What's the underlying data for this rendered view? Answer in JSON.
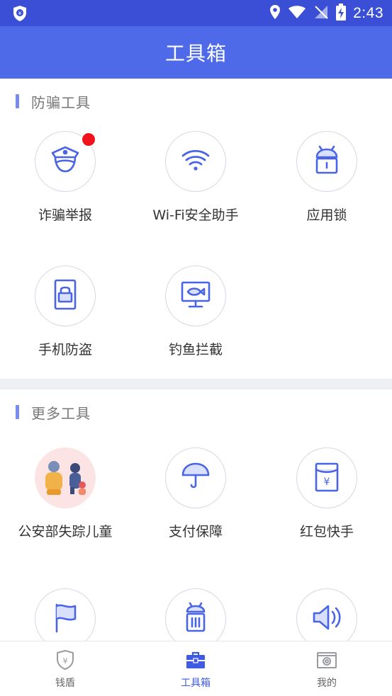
{
  "status_bar": {
    "time": "2:43"
  },
  "app_bar": {
    "title": "工具箱"
  },
  "sections": [
    {
      "title": "防骗工具",
      "tools": [
        {
          "label": "诈骗举报",
          "icon": "police-officer-icon",
          "badge": true
        },
        {
          "label": "Wi-Fi安全助手",
          "icon": "wifi-icon"
        },
        {
          "label": "应用锁",
          "icon": "android-lock-icon"
        },
        {
          "label": "手机防盗",
          "icon": "phone-lock-icon"
        },
        {
          "label": "钓鱼拦截",
          "icon": "fish-monitor-icon"
        }
      ]
    },
    {
      "title": "更多工具",
      "tools": [
        {
          "label": "公安部失踪儿童",
          "icon": "missing-children-illustration"
        },
        {
          "label": "支付保障",
          "icon": "umbrella-icon"
        },
        {
          "label": "红包快手",
          "icon": "red-envelope-yuan-icon"
        },
        {
          "label": "",
          "icon": "flag-icon"
        },
        {
          "label": "",
          "icon": "android-trash-icon"
        },
        {
          "label": "",
          "icon": "speaker-icon"
        }
      ]
    }
  ],
  "bottom_nav": [
    {
      "label": "钱盾",
      "icon": "shield-yuan-icon",
      "active": false
    },
    {
      "label": "工具箱",
      "icon": "toolbox-icon",
      "active": true
    },
    {
      "label": "我的",
      "icon": "profile-card-icon",
      "active": false
    }
  ],
  "colors": {
    "status_bar": "#3a4fd6",
    "app_bar": "#4e6ae8",
    "accent": "#4a64e6",
    "badge": "#f0131e",
    "section_bar": "#7a8bef"
  }
}
